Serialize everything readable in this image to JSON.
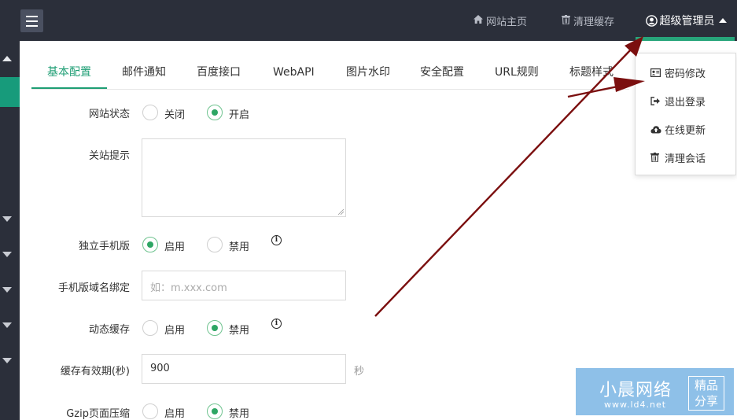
{
  "header": {
    "menu_icon": "hamburger-icon",
    "site_home": {
      "icon": "home-icon",
      "label": "网站主页"
    },
    "clear_cache": {
      "icon": "trash-icon",
      "label": "清理缓存"
    },
    "admin": {
      "icon": "user-circle-icon",
      "label": "超级管理员",
      "caret": "caret-up-icon"
    }
  },
  "dropdown": {
    "items": [
      {
        "icon": "id-card-icon",
        "label": "密码修改"
      },
      {
        "icon": "sign-out-icon",
        "label": "退出登录"
      },
      {
        "icon": "cloud-upload-icon",
        "label": "在线更新"
      },
      {
        "icon": "trash-icon",
        "label": "清理会话"
      }
    ]
  },
  "tabs": [
    {
      "label": "基本配置",
      "active": true
    },
    {
      "label": "邮件通知"
    },
    {
      "label": "百度接口"
    },
    {
      "label": "WebAPI"
    },
    {
      "label": "图片水印"
    },
    {
      "label": "安全配置"
    },
    {
      "label": "URL规则"
    },
    {
      "label": "标题样式"
    }
  ],
  "form": {
    "site_status": {
      "label": "网站状态",
      "options": [
        "关闭",
        "开启"
      ],
      "selected": "开启"
    },
    "close_tip": {
      "label": "关站提示",
      "value": ""
    },
    "mobile_site": {
      "label": "独立手机版",
      "options": [
        "启用",
        "禁用"
      ],
      "selected": "启用"
    },
    "mobile_domain": {
      "label": "手机版域名绑定",
      "placeholder": "如：m.xxx.com",
      "value": ""
    },
    "dynamic_cache": {
      "label": "动态缓存",
      "options": [
        "启用",
        "禁用"
      ],
      "selected": "禁用"
    },
    "cache_ttl": {
      "label": "缓存有效期(秒)",
      "value": "900",
      "unit": "秒"
    },
    "gzip": {
      "label": "Gzip页面压缩",
      "options": [
        "启用",
        "禁用"
      ],
      "selected": "禁用"
    }
  },
  "watermark": {
    "title": "小晨网络",
    "url": "www.ld4.net",
    "badge_line1": "精品",
    "badge_line2": "分享"
  },
  "colors": {
    "topbar_bg": "#2b2f3a",
    "accent_green": "#1e9e74",
    "arrow_red": "#7b0f0f",
    "watermark_blue": "#8ec0e8"
  }
}
